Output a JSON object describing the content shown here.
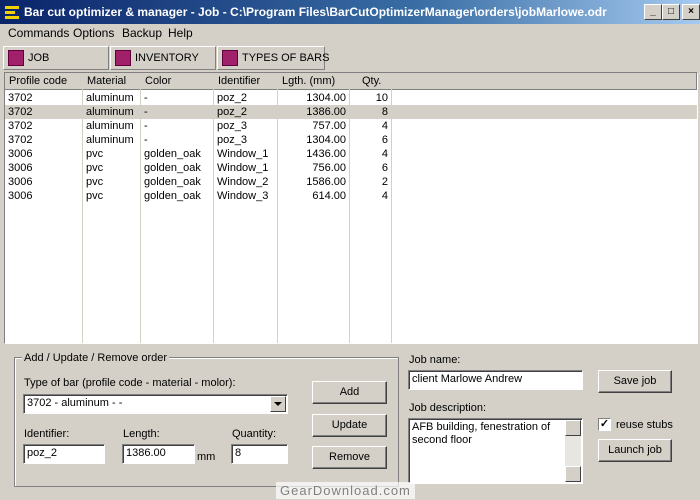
{
  "window": {
    "title": "Bar cut optimizer & manager - Job - C:\\Program Files\\BarCutOptimizerManager\\orders\\jobMarlowe.odr",
    "icon": "app-icon",
    "controls": [
      "_",
      "□",
      "×"
    ]
  },
  "menu": [
    {
      "label": "Commands",
      "accel": "C"
    },
    {
      "label": "Options",
      "accel": "O"
    },
    {
      "label": "Backup",
      "accel": "B"
    },
    {
      "label": "Help",
      "accel": "H"
    }
  ],
  "tabs": [
    {
      "label": "JOB",
      "icon": "key-icon"
    },
    {
      "label": "INVENTORY",
      "icon": "inventory-icon"
    },
    {
      "label": "TYPES OF BARS",
      "icon": "bars-icon"
    }
  ],
  "table": {
    "columns": [
      "Profile code",
      "Material",
      "Color",
      "Identifier",
      "Lgth. (mm)",
      "Qty."
    ],
    "rows": [
      [
        "3702",
        "aluminum",
        "-",
        "poz_2",
        "1304.00",
        "10"
      ],
      [
        "3702",
        "aluminum",
        "-",
        "poz_2",
        "1386.00",
        "8"
      ],
      [
        "3702",
        "aluminum",
        "-",
        "poz_3",
        "757.00",
        "4"
      ],
      [
        "3702",
        "aluminum",
        "-",
        "poz_3",
        "1304.00",
        "6"
      ],
      [
        "3006",
        "pvc",
        "golden_oak",
        "Window_1",
        "1436.00",
        "4"
      ],
      [
        "3006",
        "pvc",
        "golden_oak",
        "Window_1",
        "756.00",
        "6"
      ],
      [
        "3006",
        "pvc",
        "golden_oak",
        "Window_2",
        "1586.00",
        "2"
      ],
      [
        "3006",
        "pvc",
        "golden_oak",
        "Window_3",
        "614.00",
        "4"
      ]
    ],
    "selected_row": 1
  },
  "order_form": {
    "group_title": "Add / Update / Remove order",
    "type_label": "Type of bar (profile code - material - molor):",
    "type_value": "3702 - aluminum - -",
    "identifier_label": "Identifier:",
    "identifier_value": "poz_2",
    "length_label": "Length:",
    "length_value": "1386.00",
    "length_unit": "mm",
    "quantity_label": "Quantity:",
    "quantity_value": "8",
    "add_label": "Add",
    "update_label": "Update",
    "remove_label": "Remove"
  },
  "job": {
    "name_label": "Job name:",
    "name_value": "client Marlowe Andrew",
    "desc_label": "Job description:",
    "desc_value": "AFB building, fenestration of second floor",
    "save_label": "Save job",
    "reuse_label": "reuse stubs",
    "reuse_checked": true,
    "launch_label": "Launch job"
  },
  "watermark": "GearDownload.com"
}
